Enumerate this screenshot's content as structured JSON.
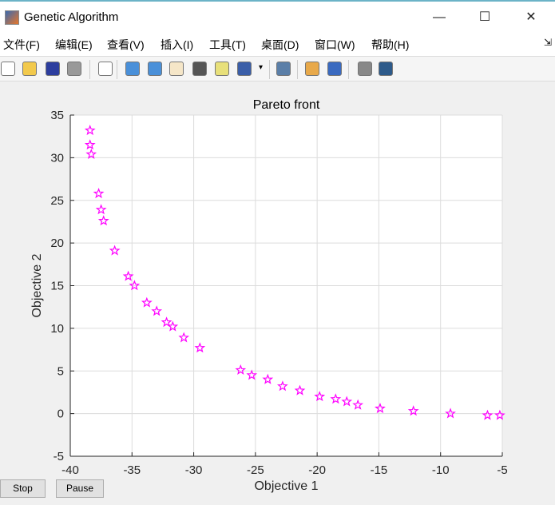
{
  "window": {
    "title": "Genetic Algorithm",
    "minimize": "—",
    "maximize": "☐",
    "close": "✕"
  },
  "menu": [
    "文件(F)",
    "编辑(E)",
    "查看(V)",
    "插入(I)",
    "工具(T)",
    "桌面(D)",
    "窗口(W)",
    "帮助(H)"
  ],
  "toolbar_icons": [
    "new-file-icon",
    "open-folder-icon",
    "save-icon",
    "print-icon",
    "pointer-icon",
    "zoom-in-icon",
    "zoom-out-icon",
    "pan-hand-icon",
    "rotate-3d-icon",
    "data-cursor-icon",
    "brush-icon",
    "brush-dropdown-icon",
    "link-plot-icon",
    "colorbar-icon",
    "legend-icon",
    "hide-plot-tools-icon",
    "show-plot-tools-icon"
  ],
  "buttons": {
    "stop": "Stop",
    "pause": "Pause"
  },
  "colors": {
    "marker": "#ff00ff",
    "grid": "#dcdcdc"
  },
  "chart_data": {
    "type": "scatter",
    "title": "Pareto front",
    "xlabel": "Objective 1",
    "ylabel": "Objective 2",
    "xlim": [
      -40,
      -5
    ],
    "ylim": [
      -5,
      35
    ],
    "xticks": [
      -40,
      -35,
      -30,
      -25,
      -20,
      -15,
      -10,
      -5
    ],
    "yticks": [
      -5,
      0,
      5,
      10,
      15,
      20,
      25,
      30,
      35
    ],
    "grid": true,
    "marker": "pentagram",
    "points": [
      [
        -38.4,
        33.2
      ],
      [
        -38.4,
        31.5
      ],
      [
        -38.3,
        30.4
      ],
      [
        -37.7,
        25.8
      ],
      [
        -37.5,
        23.9
      ],
      [
        -37.3,
        22.6
      ],
      [
        -36.4,
        19.1
      ],
      [
        -35.3,
        16.1
      ],
      [
        -34.8,
        15.0
      ],
      [
        -33.8,
        13.0
      ],
      [
        -33.0,
        12.0
      ],
      [
        -32.2,
        10.7
      ],
      [
        -31.7,
        10.2
      ],
      [
        -30.8,
        8.9
      ],
      [
        -29.5,
        7.7
      ],
      [
        -26.2,
        5.1
      ],
      [
        -25.3,
        4.5
      ],
      [
        -24.0,
        4.0
      ],
      [
        -22.8,
        3.2
      ],
      [
        -21.4,
        2.7
      ],
      [
        -19.8,
        2.0
      ],
      [
        -18.5,
        1.7
      ],
      [
        -17.6,
        1.4
      ],
      [
        -16.7,
        1.0
      ],
      [
        -14.9,
        0.6
      ],
      [
        -12.2,
        0.3
      ],
      [
        -9.2,
        0.0
      ],
      [
        -6.2,
        -0.2
      ],
      [
        -5.2,
        -0.2
      ]
    ]
  }
}
